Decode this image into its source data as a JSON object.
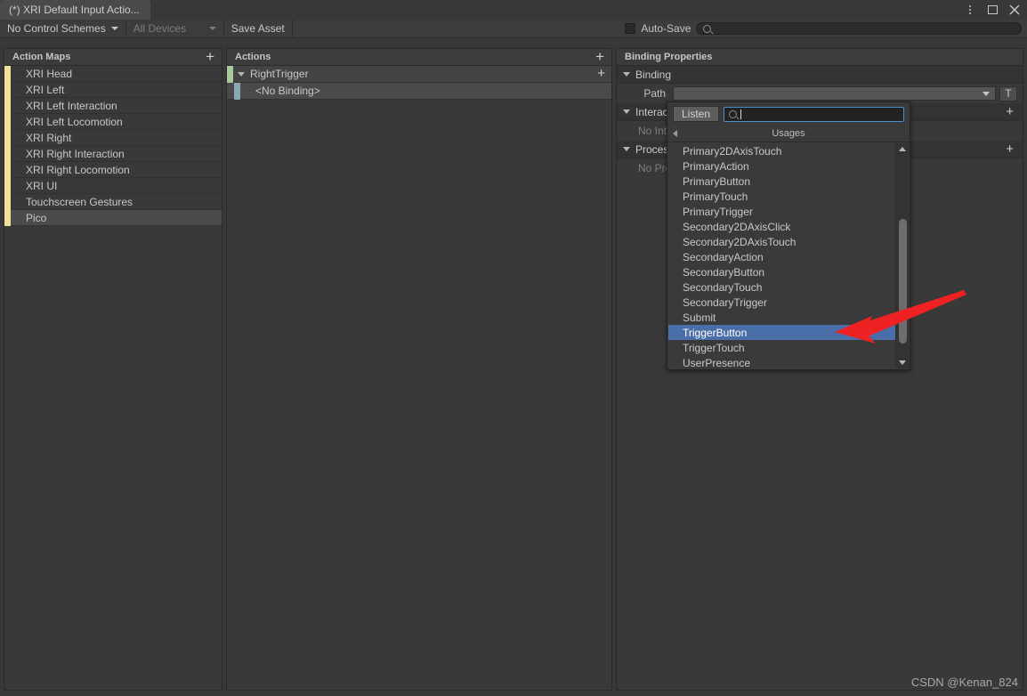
{
  "window": {
    "tab_title": "(*) XRI Default Input Actio...",
    "controls": {
      "menu": "kebab-menu-icon",
      "maximize": "maximize-icon",
      "close": "close-icon"
    }
  },
  "toolbar": {
    "control_schemes": "No Control Schemes",
    "devices": "All Devices",
    "save_asset": "Save Asset",
    "auto_save_label": "Auto-Save",
    "auto_save_checked": false,
    "search_placeholder": ""
  },
  "action_maps": {
    "header": "Action Maps",
    "add_label": "+",
    "accent_color": "#f2e09a",
    "items": [
      {
        "label": "XRI Head",
        "selected": false
      },
      {
        "label": "XRI Left",
        "selected": false
      },
      {
        "label": "XRI Left Interaction",
        "selected": false
      },
      {
        "label": "XRI Left Locomotion",
        "selected": false
      },
      {
        "label": "XRI Right",
        "selected": false
      },
      {
        "label": "XRI Right Interaction",
        "selected": false
      },
      {
        "label": "XRI Right Locomotion",
        "selected": false
      },
      {
        "label": "XRI UI",
        "selected": false
      },
      {
        "label": "Touchscreen Gestures",
        "selected": false
      },
      {
        "label": "Pico",
        "selected": true
      }
    ]
  },
  "actions": {
    "header": "Actions",
    "add_label": "+",
    "action_accent_color": "#a8ca98",
    "binding_accent_color": "#8aa8b0",
    "items": [
      {
        "label": "RightTrigger",
        "expanded": true,
        "add_label": "+",
        "bindings": [
          {
            "label": "<No Binding>"
          }
        ]
      }
    ]
  },
  "binding_properties": {
    "header": "Binding Properties",
    "sections": [
      {
        "label": "Binding",
        "has_add": false
      },
      {
        "label": "Interactions",
        "has_add": true,
        "empty_text": "No Interactions"
      },
      {
        "label": "Processors",
        "has_add": true,
        "empty_text": "No Processors"
      }
    ],
    "path": {
      "label": "Path",
      "value": "",
      "toggle_label": "T"
    }
  },
  "path_dropdown": {
    "listen_label": "Listen",
    "search_value": "",
    "back_icon": "back-arrow-icon",
    "header_title": "Usages",
    "selected_item": "TriggerButton",
    "highlight_color": "#4a6ea8",
    "items": [
      "Primary2DAxisTouch",
      "PrimaryAction",
      "PrimaryButton",
      "PrimaryTouch",
      "PrimaryTrigger",
      "Secondary2DAxisClick",
      "Secondary2DAxisTouch",
      "SecondaryAction",
      "SecondaryButton",
      "SecondaryTouch",
      "SecondaryTrigger",
      "Submit",
      "TriggerButton",
      "TriggerTouch",
      "UserPresence"
    ]
  },
  "annotation": {
    "arrow_color": "#ee2222",
    "points_to": "TriggerButton"
  },
  "watermark": {
    "text": "CSDN @Kenan_824"
  }
}
